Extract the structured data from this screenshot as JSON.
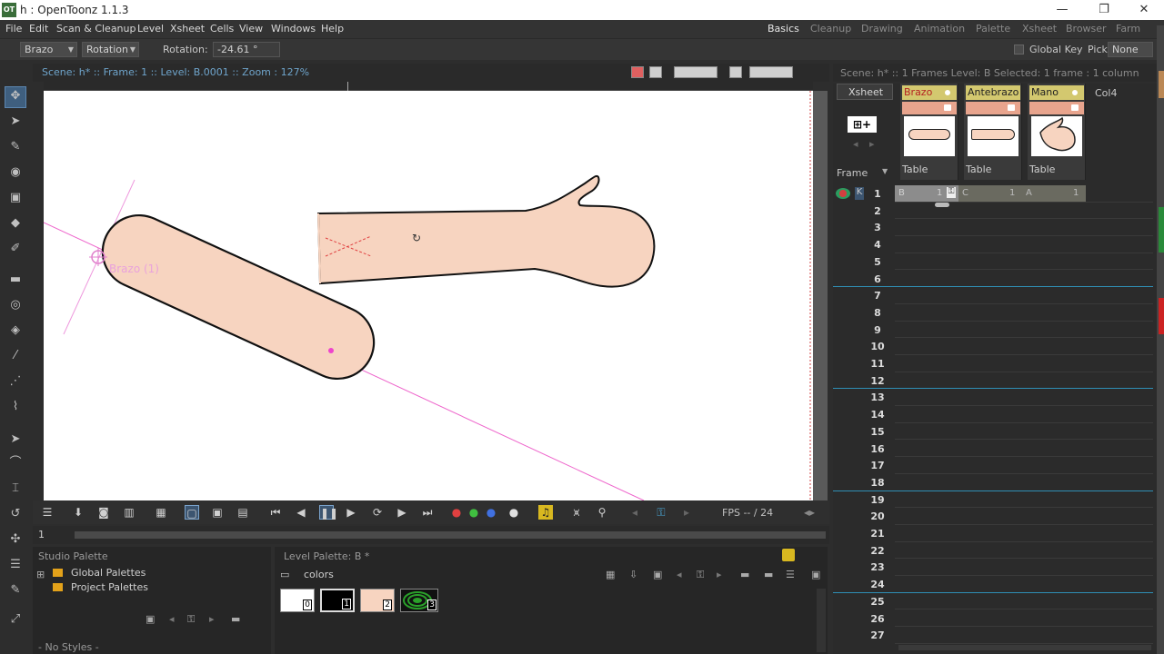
{
  "window": {
    "title": "h : OpenToonz 1.1.3",
    "app_icon": "OT",
    "minimize": "—",
    "restore": "❐",
    "close": "✕"
  },
  "menu": [
    "File",
    "Edit",
    "Scan & Cleanup",
    "Level",
    "Xsheet",
    "Cells",
    "View",
    "Windows",
    "Help"
  ],
  "rooms": [
    "Basics",
    "Cleanup",
    "Drawing",
    "Animation",
    "Palette",
    "Xsheet",
    "Browser",
    "Farm"
  ],
  "tool_options": {
    "object": "Brazo",
    "mode": "Rotation",
    "field_label": "Rotation:",
    "field_value": "-24.61 °",
    "global_key_label": "Global Key",
    "pick_label": "Pick:",
    "pick_value": "None"
  },
  "viewer": {
    "info": "Scene: h*  ::  Frame: 1  ::  Level: B.0001  ::  Zoom : 127%",
    "object_label": "Brazo  (1)",
    "fps_label": "FPS -- / 24",
    "frame_field": "1"
  },
  "studio_palette": {
    "title": "Studio Palette",
    "items": [
      "Global Palettes",
      "Project Palettes"
    ],
    "status": "- No Styles -"
  },
  "level_palette": {
    "title": "Level Palette: B *",
    "page": "colors",
    "styles": [
      {
        "id": "0",
        "color": "#ffffff"
      },
      {
        "id": "1",
        "color": "#000000"
      },
      {
        "id": "2",
        "color": "#f7d4c0"
      },
      {
        "id": "3",
        "color": "#2aa02a"
      }
    ]
  },
  "xsheet": {
    "info": "Scene: h*  ::  1 Frames  Level: B   Selected: 1 frame : 1 column",
    "xsheet_tab": "Xsheet",
    "frame_label": "Frame",
    "columns": [
      {
        "name": "Brazo",
        "pegbar": "Table",
        "cell_level": "B",
        "cell_frame": "1"
      },
      {
        "name": "Antebrazo",
        "pegbar": "Table",
        "cell_level": "C",
        "cell_frame": "1"
      },
      {
        "name": "Mano",
        "pegbar": "Table",
        "cell_level": "A",
        "cell_frame": "1"
      }
    ],
    "empty_col": "Col4",
    "rows": [
      "1",
      "2",
      "3",
      "4",
      "5",
      "6",
      "7",
      "8",
      "9",
      "10",
      "11",
      "12",
      "13",
      "14",
      "15",
      "16",
      "17",
      "18",
      "19",
      "20",
      "21",
      "22",
      "23",
      "24",
      "25",
      "26",
      "27"
    ]
  }
}
